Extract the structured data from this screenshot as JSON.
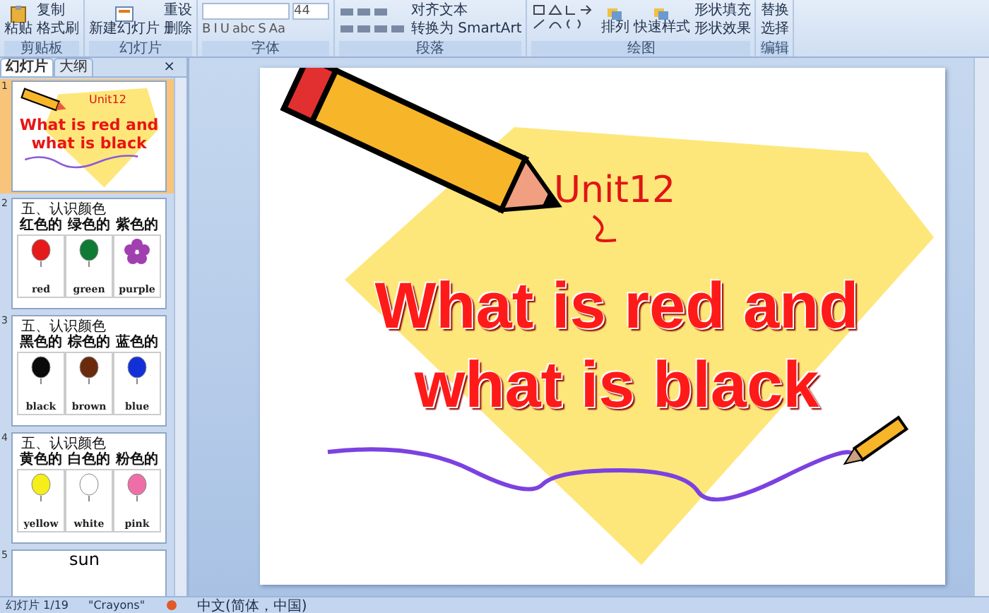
{
  "ribbon": {
    "groups": [
      {
        "kind": "clipboard",
        "label": "剪贴板",
        "big": "粘贴",
        "small": [
          "复制",
          "格式刷"
        ]
      },
      {
        "kind": "slides",
        "label": "幻灯片",
        "big": "新建幻灯片",
        "small": [
          "重设",
          "删除"
        ]
      },
      {
        "kind": "font",
        "label": "字体",
        "size": "44",
        "buttons": [
          "B",
          "I",
          "U",
          "abc",
          "S",
          "Aa"
        ]
      },
      {
        "kind": "paragraph",
        "label": "段落",
        "small": [
          "对齐文本",
          "转换为 SmartArt"
        ]
      },
      {
        "kind": "drawing",
        "label": "绘图",
        "big": [
          "排列",
          "快速样式"
        ],
        "small": [
          "形状填充",
          "形状效果"
        ]
      },
      {
        "kind": "editing",
        "label": "编辑",
        "small": [
          "替换",
          "选择"
        ]
      }
    ]
  },
  "panel": {
    "tabs": [
      {
        "label": "幻灯片",
        "selected": true
      },
      {
        "label": "大纲",
        "selected": false
      }
    ],
    "close": "×"
  },
  "thumbnails": [
    {
      "number": "1",
      "kind": "title",
      "selected": true,
      "unit": "Unit12",
      "title_lines": [
        "What is red and",
        "what is black"
      ]
    },
    {
      "number": "2",
      "kind": "colors",
      "selected": false,
      "heading": "五、认识颜色",
      "cards": [
        {
          "label": "红色的",
          "word": "red",
          "kind": "balloon",
          "color": "#e51b1b"
        },
        {
          "label": "绿色的",
          "word": "green",
          "kind": "balloon",
          "color": "#0f7a34"
        },
        {
          "label": "紫色的",
          "word": "purple",
          "kind": "flower",
          "color": "#a23fb0"
        }
      ]
    },
    {
      "number": "3",
      "kind": "colors",
      "selected": false,
      "heading": "五、认识颜色",
      "cards": [
        {
          "label": "黑色的",
          "word": "black",
          "kind": "balloon",
          "color": "#0a0a0a"
        },
        {
          "label": "棕色的",
          "word": "brown",
          "kind": "balloon",
          "color": "#6b2a0c"
        },
        {
          "label": "蓝色的",
          "word": "blue",
          "kind": "balloon",
          "color": "#1330d8"
        }
      ]
    },
    {
      "number": "4",
      "kind": "colors",
      "selected": false,
      "heading": "五、认识颜色",
      "cards": [
        {
          "label": "黄色的",
          "word": "yellow",
          "kind": "balloon",
          "color": "#f5ee1a"
        },
        {
          "label": "白色的",
          "word": "white",
          "kind": "balloon",
          "color": "#ffffff"
        },
        {
          "label": "粉色的",
          "word": "pink",
          "kind": "balloon",
          "color": "#ee6fa8"
        }
      ]
    },
    {
      "number": "5",
      "kind": "word",
      "selected": false,
      "word": "sun"
    }
  ],
  "slide": {
    "unit": "Unit12",
    "title_lines": [
      "What is red and",
      "what is black"
    ]
  },
  "status_bar": {
    "slide": "幻灯片 1/19",
    "theme": "\"Crayons\"",
    "language": "中文(简体，中国)"
  }
}
